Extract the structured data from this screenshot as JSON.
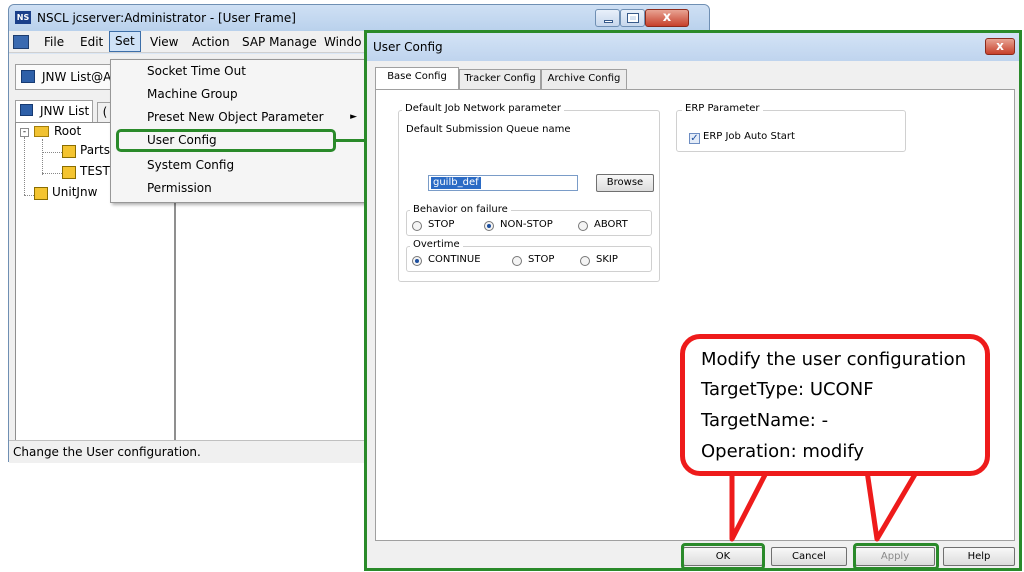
{
  "main_window": {
    "icon_text": "NS",
    "title": "NSCL jcserver:Administrator - [User Frame]",
    "close_glyph": "x",
    "menu": [
      "File",
      "Edit",
      "Set",
      "View",
      "Action",
      "SAP Manage",
      "Windo"
    ],
    "toolbar_button": "JNW List@A",
    "tabs": [
      "JNW List",
      "("
    ],
    "tree": {
      "root": "Root",
      "children": [
        "Parts",
        "TEST"
      ],
      "sibling": "UnitJnw"
    },
    "status": "Change the User configuration."
  },
  "set_menu": {
    "items": [
      "Socket Time Out",
      "Machine Group",
      "Preset New Object Parameter",
      "User Config",
      "System Config",
      "Permission"
    ],
    "submenu_arrow": "►"
  },
  "dialog": {
    "title": "User Config",
    "close_glyph": "x",
    "tabs": [
      "Base Config",
      "Tracker Config",
      "Archive Config"
    ],
    "default_jn_group": "Default Job Network parameter",
    "queue_label": "Default Submission Queue name",
    "queue_value": "guilb_def",
    "browse_label": "Browse",
    "behavior_group": "Behavior on failure",
    "behavior_options": [
      "STOP",
      "NON-STOP",
      "ABORT"
    ],
    "behavior_selected": "NON-STOP",
    "overtime_group": "Overtime",
    "overtime_options": [
      "CONTINUE",
      "STOP",
      "SKIP"
    ],
    "overtime_selected": "CONTINUE",
    "erp_group": "ERP Parameter",
    "erp_check_label": "ERP Job Auto Start",
    "erp_checked": true,
    "check_glyph": "✓",
    "buttons": [
      "OK",
      "Cancel",
      "Apply",
      "Help"
    ]
  },
  "callout": {
    "lines": [
      "Modify the user configuration",
      "TargetType: UCONF",
      "TargetName: -",
      "Operation: modify"
    ]
  },
  "colors": {
    "highlight": "#2a8a2a",
    "callout_border": "#ee1b1b"
  }
}
